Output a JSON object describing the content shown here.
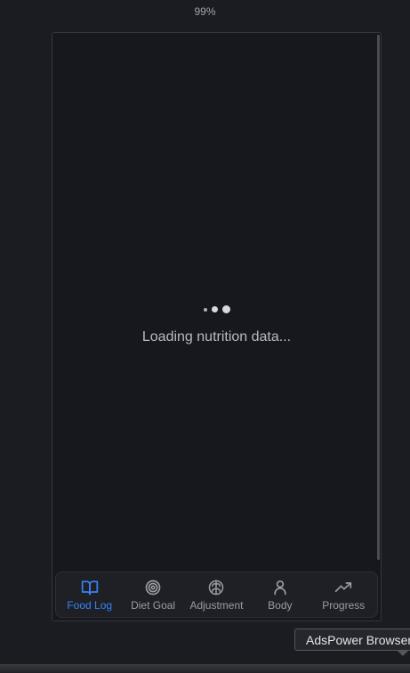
{
  "zoom_label": "99%",
  "loading": {
    "text": "Loading nutrition data..."
  },
  "nav": {
    "items": [
      {
        "label": "Food Log",
        "icon": "book-open-icon",
        "active": true
      },
      {
        "label": "Diet Goal",
        "icon": "target-icon",
        "active": false
      },
      {
        "label": "Adjustment",
        "icon": "brain-icon",
        "active": false
      },
      {
        "label": "Body",
        "icon": "user-icon",
        "active": false
      },
      {
        "label": "Progress",
        "icon": "trending-up-icon",
        "active": false
      }
    ]
  },
  "tooltip": {
    "text": "AdsPower Browser"
  },
  "colors": {
    "accent": "#3b82f6",
    "background": "#17181d"
  }
}
